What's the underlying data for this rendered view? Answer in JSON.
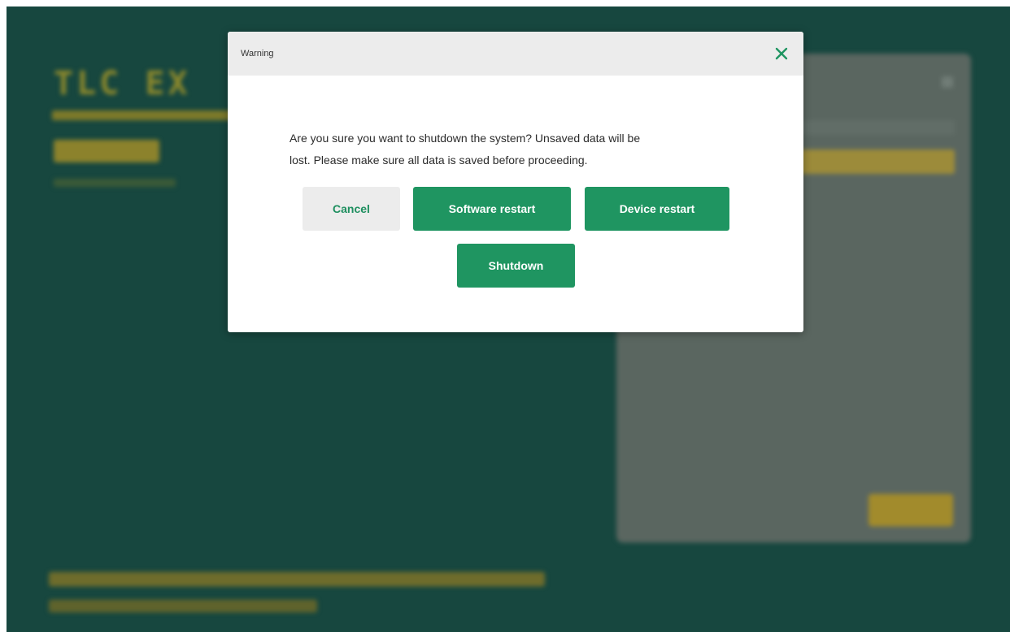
{
  "background": {
    "app_title": "TLC EX"
  },
  "dialog": {
    "title": "Warning",
    "message_lines": [
      "Are you sure you want to shutdown the system? Unsaved data will be",
      "lost. Please make sure all data is saved before proceeding."
    ],
    "buttons": {
      "cancel": "Cancel",
      "software_restart": "Software restart",
      "device_restart": "Device restart",
      "shutdown": "Shutdown"
    },
    "close_icon": "close-icon"
  },
  "colors": {
    "background_dark_green": "#17473f",
    "primary_green": "#1f9561",
    "dialog_header": "#ececec",
    "cancel_text": "#1e8f5f"
  }
}
